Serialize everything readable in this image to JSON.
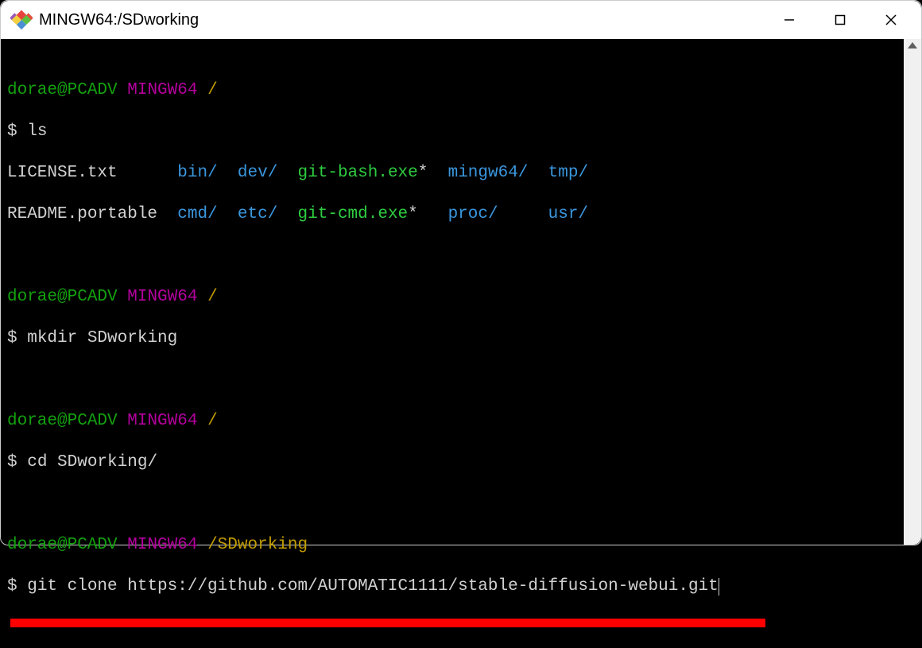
{
  "window": {
    "title": "MINGW64:/SDworking"
  },
  "prompt": {
    "user_host": "dorae@PCADV",
    "env": "MINGW64",
    "root_path": "/",
    "working_path": "/SDworking",
    "dollar": "$"
  },
  "cmds": {
    "ls": "ls",
    "mkdir": "mkdir SDworking",
    "cd": "cd SDworking/",
    "gitclone": "git clone https://github.com/AUTOMATIC1111/stable-diffusion-webui.git"
  },
  "ls_output": {
    "license": "LICENSE.txt",
    "readme": "README.portable",
    "bin": "bin/",
    "cmd": "cmd/",
    "dev": "dev/",
    "etc": "etc/",
    "gitbash": "git-bash.exe",
    "gitcmd": "git-cmd.exe",
    "star": "*",
    "mingw64": "mingw64/",
    "proc": "proc/",
    "tmp": "tmp/",
    "usr": "usr/"
  }
}
